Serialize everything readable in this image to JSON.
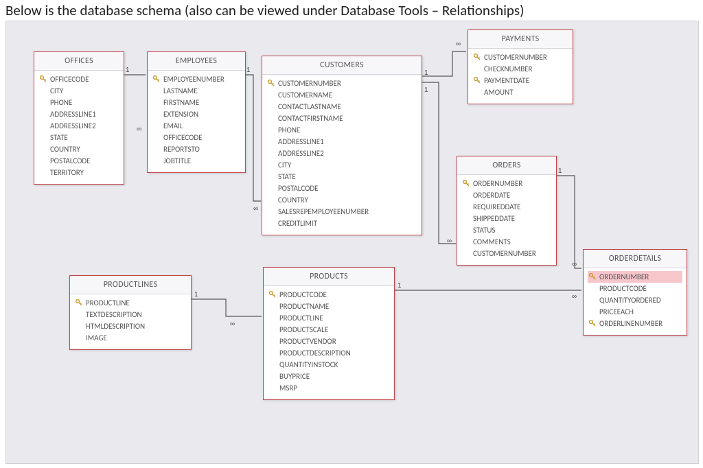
{
  "caption": "Below is the database schema (also can be viewed under Database Tools – Relationships)",
  "tables": {
    "offices": {
      "title": "OFFICES",
      "fields": [
        {
          "name": "OFFICECODE",
          "pk": true
        },
        {
          "name": "CITY"
        },
        {
          "name": "PHONE"
        },
        {
          "name": "ADDRESSLINE1"
        },
        {
          "name": "ADDRESSLINE2"
        },
        {
          "name": "STATE"
        },
        {
          "name": "COUNTRY"
        },
        {
          "name": "POSTALCODE"
        },
        {
          "name": "TERRITORY"
        }
      ]
    },
    "employees": {
      "title": "EMPLOYEES",
      "fields": [
        {
          "name": "EMPLOYEENUMBER",
          "pk": true
        },
        {
          "name": "LASTNAME"
        },
        {
          "name": "FIRSTNAME"
        },
        {
          "name": "EXTENSION"
        },
        {
          "name": "EMAIL"
        },
        {
          "name": "OFFICECODE"
        },
        {
          "name": "REPORTSTO"
        },
        {
          "name": "JOBTITLE"
        }
      ]
    },
    "customers": {
      "title": "CUSTOMERS",
      "fields": [
        {
          "name": "CUSTOMERNUMBER",
          "pk": true
        },
        {
          "name": "CUSTOMERNAME"
        },
        {
          "name": "CONTACTLASTNAME"
        },
        {
          "name": "CONTACTFIRSTNAME"
        },
        {
          "name": "PHONE"
        },
        {
          "name": "ADDRESSLINE1"
        },
        {
          "name": "ADDRESSLINE2"
        },
        {
          "name": "CITY"
        },
        {
          "name": "STATE"
        },
        {
          "name": "POSTALCODE"
        },
        {
          "name": "COUNTRY"
        },
        {
          "name": "SALESREPEMPLOYEENUMBER"
        },
        {
          "name": "CREDITLIMIT"
        }
      ]
    },
    "payments": {
      "title": "PAYMENTS",
      "fields": [
        {
          "name": "CUSTOMERNUMBER",
          "pk": true
        },
        {
          "name": "CHECKNUMBER"
        },
        {
          "name": "PAYMENTDATE",
          "pk": true
        },
        {
          "name": "AMOUNT"
        }
      ]
    },
    "orders": {
      "title": "ORDERS",
      "fields": [
        {
          "name": "ORDERNUMBER",
          "pk": true
        },
        {
          "name": "ORDERDATE"
        },
        {
          "name": "REQUIREDDATE"
        },
        {
          "name": "SHIPPEDDATE"
        },
        {
          "name": "STATUS"
        },
        {
          "name": "COMMENTS"
        },
        {
          "name": "CUSTOMERNUMBER"
        }
      ]
    },
    "orderdetails": {
      "title": "ORDERDETAILS",
      "fields": [
        {
          "name": "ORDERNUMBER",
          "pk": true,
          "selected": true
        },
        {
          "name": "PRODUCTCODE"
        },
        {
          "name": "QUANTITYORDERED"
        },
        {
          "name": "PRICEEACH"
        },
        {
          "name": "ORDERLINENUMBER",
          "pk": true
        }
      ]
    },
    "productlines": {
      "title": "PRODUCTLINES",
      "fields": [
        {
          "name": "PRODUCTLINE",
          "pk": true
        },
        {
          "name": "TEXTDESCRIPTION"
        },
        {
          "name": "HTMLDESCRIPTION"
        },
        {
          "name": "IMAGE"
        }
      ]
    },
    "products": {
      "title": "PRODUCTS",
      "fields": [
        {
          "name": "PRODUCTCODE",
          "pk": true
        },
        {
          "name": "PRODUCTNAME"
        },
        {
          "name": "PRODUCTLINE"
        },
        {
          "name": "PRODUCTSCALE"
        },
        {
          "name": "PRODUCTVENDOR"
        },
        {
          "name": "PRODUCTDESCRIPTION"
        },
        {
          "name": "QUANTITYINSTOCK"
        },
        {
          "name": "BUYPRICE"
        },
        {
          "name": "MSRP"
        }
      ]
    }
  },
  "cardinality": {
    "one": "1",
    "many": "∞"
  },
  "relationships": [
    {
      "from": "offices.OFFICECODE",
      "to": "employees.OFFICECODE",
      "type": "1:∞"
    },
    {
      "from": "employees.EMPLOYEENUMBER",
      "to": "customers.SALESREPEMPLOYEENUMBER",
      "type": "1:∞"
    },
    {
      "from": "customers.CUSTOMERNUMBER",
      "to": "payments.CUSTOMERNUMBER",
      "type": "1:∞"
    },
    {
      "from": "customers.CUSTOMERNUMBER",
      "to": "orders.CUSTOMERNUMBER",
      "type": "1:∞"
    },
    {
      "from": "orders.ORDERNUMBER",
      "to": "orderdetails.ORDERNUMBER",
      "type": "1:∞"
    },
    {
      "from": "products.PRODUCTCODE",
      "to": "orderdetails.PRODUCTCODE",
      "type": "1:∞"
    },
    {
      "from": "productlines.PRODUCTLINE",
      "to": "products.PRODUCTLINE",
      "type": "1:∞"
    }
  ]
}
